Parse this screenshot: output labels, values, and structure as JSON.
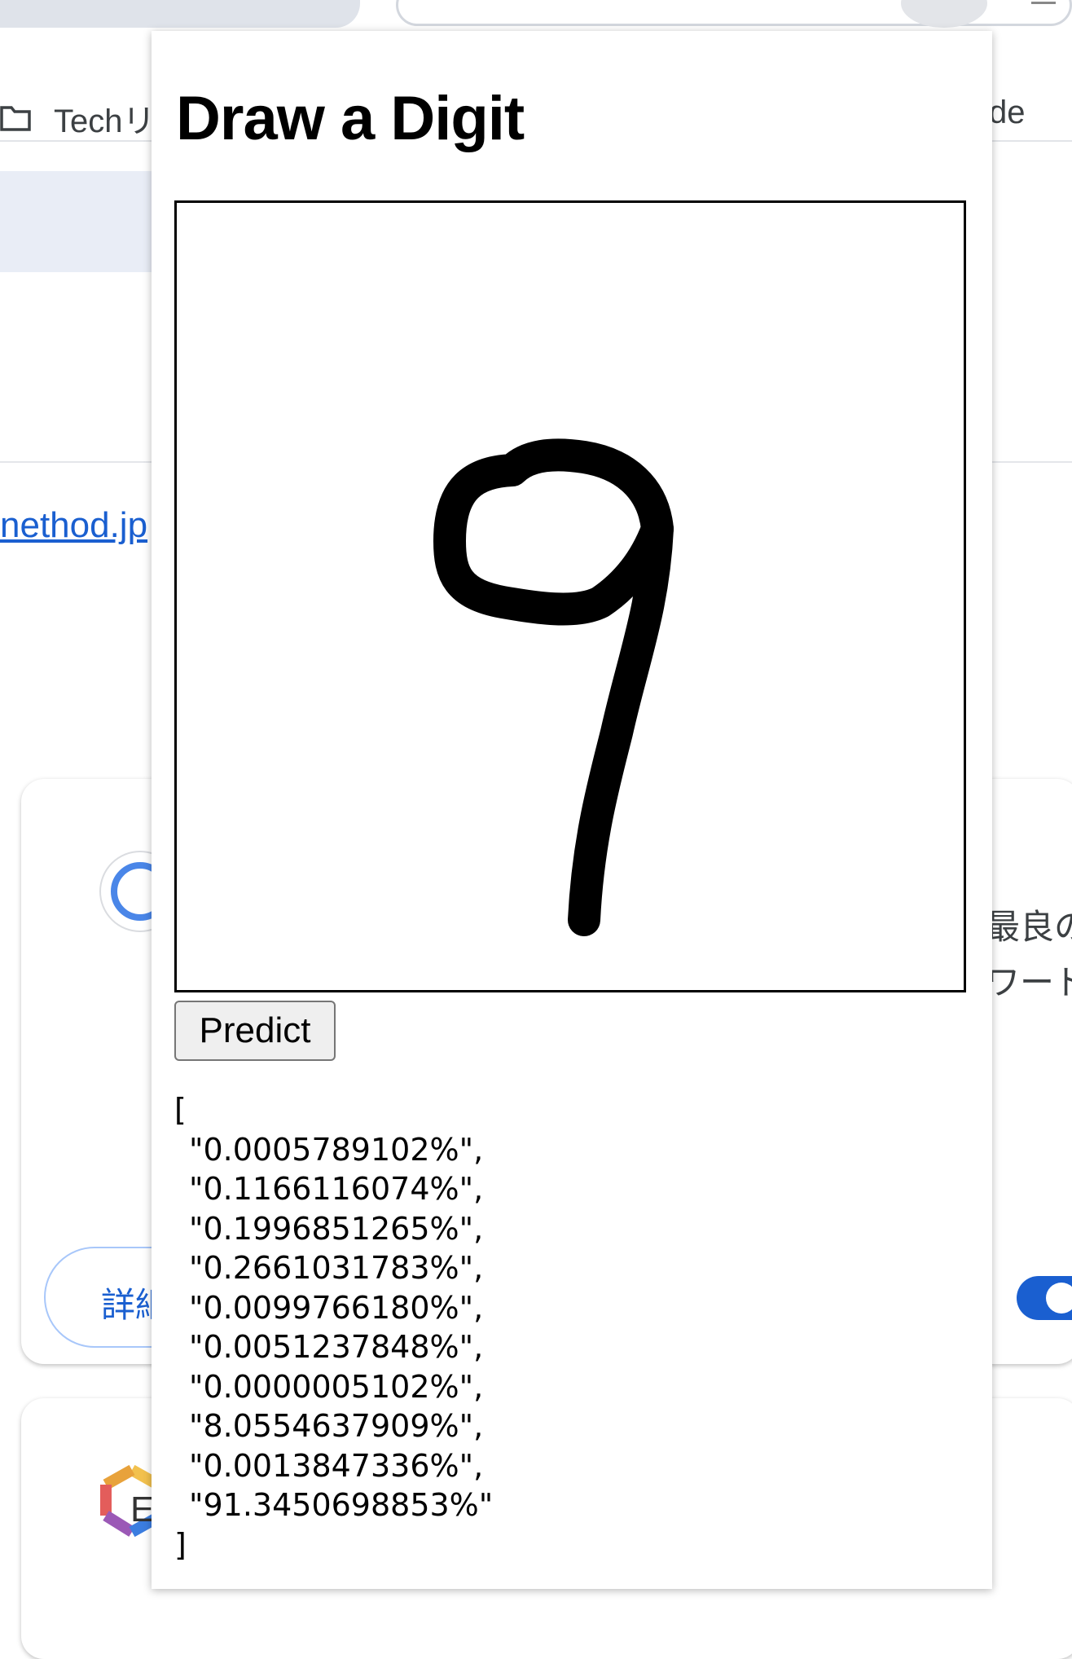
{
  "browser": {
    "bookmark_left": "Techリ",
    "bookmark_right": "de"
  },
  "background_page": {
    "link_text": "nethod.jp",
    "detail_button": "詳細",
    "right_text_1": "最良の",
    "right_text_2": "ワード",
    "logo_letter": "E"
  },
  "popup": {
    "title": "Draw a Digit",
    "predict_label": "Predict",
    "output_open": "[",
    "output_close": "]",
    "predictions": [
      "\"0.0005789102%\",",
      "\"0.1166116074%\",",
      "\"0.1996851265%\",",
      "\"0.2661031783%\",",
      "\"0.0099766180%\",",
      "\"0.0051237848%\",",
      "\"0.0000005102%\",",
      "\"8.0554637909%\",",
      "\"0.0013847336%\",",
      "\"91.3450698853%\""
    ]
  },
  "colors": {
    "link": "#1a5fd0",
    "tab_inactive": "#dfe3ea",
    "accent_blue": "#4a86e8"
  }
}
